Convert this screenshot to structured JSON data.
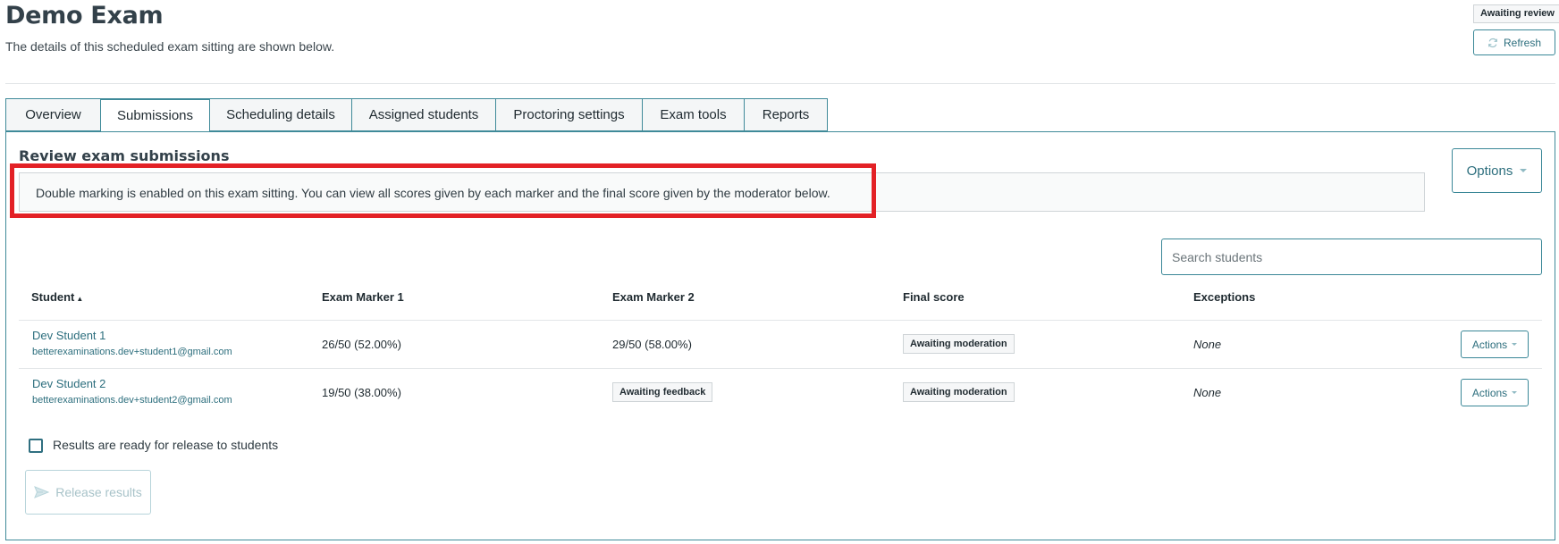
{
  "header": {
    "title": "Demo Exam",
    "subtitle": "The details of this scheduled exam sitting are shown below.",
    "status_badge": "Awaiting review",
    "refresh_label": "Refresh"
  },
  "tabs": [
    {
      "label": "Overview",
      "active": false
    },
    {
      "label": "Submissions",
      "active": true
    },
    {
      "label": "Scheduling details",
      "active": false
    },
    {
      "label": "Assigned students",
      "active": false
    },
    {
      "label": "Proctoring settings",
      "active": false
    },
    {
      "label": "Exam tools",
      "active": false
    },
    {
      "label": "Reports",
      "active": false
    }
  ],
  "submissions": {
    "section_title": "Review exam submissions",
    "info_message": "Double marking is enabled on this exam sitting. You can view all scores given by each marker and the final score given by the moderator below.",
    "options_label": "Options",
    "search": {
      "placeholder": "Search students",
      "value": ""
    },
    "table": {
      "columns": [
        "Student",
        "Exam Marker 1",
        "Exam Marker 2",
        "Final score",
        "Exceptions"
      ],
      "sort_indicator": "▲",
      "rows": [
        {
          "name": "Dev Student 1",
          "email": "betterexaminations.dev+student1@gmail.com",
          "marker1": "26/50 (52.00%)",
          "marker2": "29/50 (58.00%)",
          "final_score": "Awaiting moderation",
          "exceptions": "None",
          "actions_label": "Actions"
        },
        {
          "name": "Dev Student 2",
          "email": "betterexaminations.dev+student2@gmail.com",
          "marker1": "19/50 (38.00%)",
          "marker2": "Awaiting feedback",
          "final_score": "Awaiting moderation",
          "exceptions": "None",
          "actions_label": "Actions"
        }
      ]
    },
    "release_checkbox_label": "Results are ready for release to students",
    "release_checked": false,
    "release_button_label": "Release results"
  },
  "colors": {
    "accent": "#3a8797",
    "highlight": "#e32126",
    "title_text": "#33414a"
  }
}
